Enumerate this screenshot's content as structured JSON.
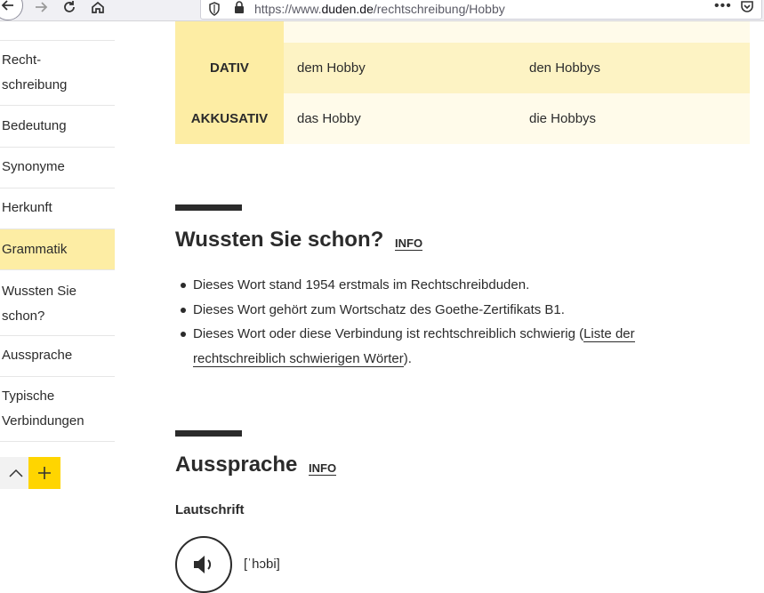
{
  "browser": {
    "url_prefix": "https://www.",
    "url_domain": "duden.de",
    "url_path": "/rechtschreibung/Hobby",
    "menu_dots": "•••"
  },
  "sidebar": {
    "items": [
      {
        "label": "Recht-\nschreibung"
      },
      {
        "label": "Bedeutung"
      },
      {
        "label": "Synonyme"
      },
      {
        "label": "Herkunft"
      },
      {
        "label": "Grammatik"
      },
      {
        "label": "Wussten Sie\nschon?"
      },
      {
        "label": "Aussprache"
      },
      {
        "label": "Typische\nVerbindungen"
      }
    ],
    "active_index": 4
  },
  "declension": {
    "rows": [
      {
        "case": "DATIV",
        "singular": "dem Hobby",
        "plural": "den Hobbys"
      },
      {
        "case": "AKKUSATIV",
        "singular": "das Hobby",
        "plural": "die Hobbys"
      }
    ]
  },
  "wussten": {
    "title": "Wussten Sie schon?",
    "info_label": "INFO",
    "bullets": [
      "Dieses Wort stand 1954 erstmals im Rechtschreibduden.",
      "Dieses Wort gehört zum Wortschatz des Goethe-Zertifikats B1."
    ],
    "bullet3_prefix": "Dieses Wort oder diese Verbindung ist rechtschreiblich schwierig (",
    "bullet3_link": "Liste der rechtschreiblich schwierigen Wörter",
    "bullet3_suffix": ")."
  },
  "aussprache": {
    "title": "Aussprache",
    "info_label": "INFO",
    "lautschrift_label": "Lautschrift",
    "ipa": "[ˈhɔbi]"
  },
  "colors": {
    "highlight": "#fdeda4",
    "accent_yellow": "#ffd500",
    "text": "#2b2b2b"
  }
}
